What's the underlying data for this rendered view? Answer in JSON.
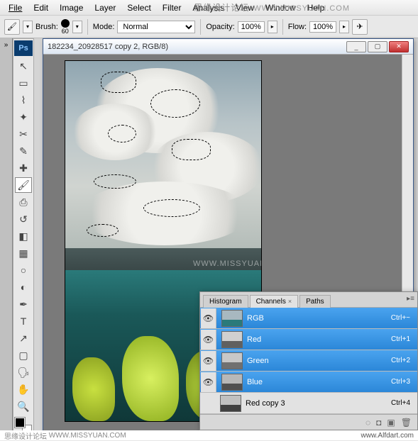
{
  "menu": [
    "File",
    "Edit",
    "Image",
    "Layer",
    "Select",
    "Filter",
    "Analysis",
    "View",
    "Window",
    "Help"
  ],
  "options": {
    "brush_label": "Brush:",
    "brush_size": "60",
    "mode_label": "Mode:",
    "mode_value": "Normal",
    "opacity_label": "Opacity:",
    "opacity_value": "100%",
    "flow_label": "Flow:",
    "flow_value": "100%"
  },
  "document": {
    "title": "182234_20928517 copy 2, RGB/8)"
  },
  "watermark": {
    "cn": "思缘设计论坛",
    "url": "WWW.MISSYUAN.COM",
    "alfdart": "www.Alfdart.com"
  },
  "panel": {
    "tabs": [
      "Histogram",
      "Channels",
      "Paths"
    ],
    "active_tab": 1,
    "channels": [
      {
        "name": "RGB",
        "shortcut": "Ctrl+~",
        "selected": true,
        "visible": true,
        "rgb": true
      },
      {
        "name": "Red",
        "shortcut": "Ctrl+1",
        "selected": true,
        "visible": true,
        "color": "red"
      },
      {
        "name": "Green",
        "shortcut": "Ctrl+2",
        "selected": true,
        "visible": true,
        "color": "green"
      },
      {
        "name": "Blue",
        "shortcut": "Ctrl+3",
        "selected": true,
        "visible": true,
        "color": "blue"
      },
      {
        "name": "Red copy 3",
        "shortcut": "Ctrl+4",
        "selected": false,
        "visible": false,
        "color": "gray"
      }
    ]
  },
  "tools": [
    {
      "name": "move-tool",
      "glyph": "↖"
    },
    {
      "name": "marquee-tool",
      "glyph": "▭"
    },
    {
      "name": "lasso-tool",
      "glyph": "⌇"
    },
    {
      "name": "wand-tool",
      "glyph": "✦"
    },
    {
      "name": "crop-tool",
      "glyph": "✂"
    },
    {
      "name": "eyedropper-tool",
      "glyph": "✎"
    },
    {
      "name": "healing-tool",
      "glyph": "✚"
    },
    {
      "name": "brush-tool",
      "glyph": "🖌",
      "selected": true
    },
    {
      "name": "stamp-tool",
      "glyph": "⎙"
    },
    {
      "name": "history-brush-tool",
      "glyph": "↺"
    },
    {
      "name": "eraser-tool",
      "glyph": "◧"
    },
    {
      "name": "gradient-tool",
      "glyph": "▦"
    },
    {
      "name": "blur-tool",
      "glyph": "○"
    },
    {
      "name": "dodge-tool",
      "glyph": "◐"
    },
    {
      "name": "pen-tool",
      "glyph": "✒"
    },
    {
      "name": "type-tool",
      "glyph": "T"
    },
    {
      "name": "path-tool",
      "glyph": "↗"
    },
    {
      "name": "shape-tool",
      "glyph": "▢"
    },
    {
      "name": "notes-tool",
      "glyph": "🗣"
    },
    {
      "name": "hand-tool",
      "glyph": "✋"
    },
    {
      "name": "zoom-tool",
      "glyph": "🔍"
    }
  ]
}
